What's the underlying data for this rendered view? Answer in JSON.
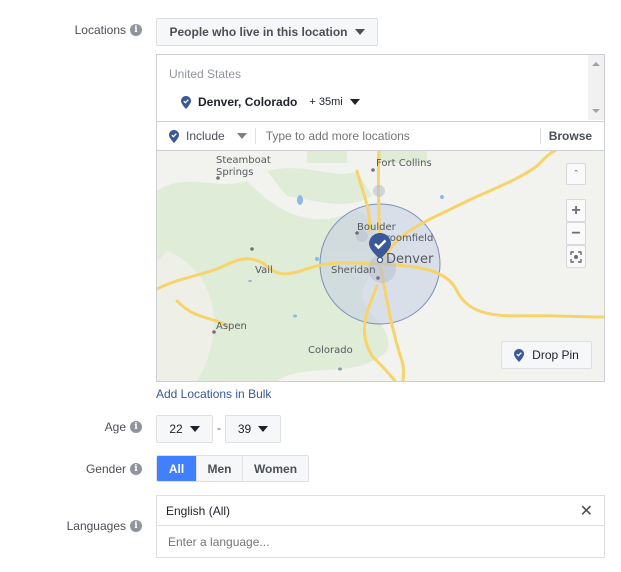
{
  "locations": {
    "label": "Locations",
    "type_dropdown": "People who live in this location",
    "country": "United States",
    "selected": {
      "name": "Denver, Colorado",
      "radius": "+ 35mi"
    },
    "include_label": "Include",
    "search_placeholder": "Type to add more locations",
    "browse_label": "Browse",
    "map": {
      "labels": [
        "Steamboat Springs",
        "Fort Collins",
        "Boulder",
        "Broomfield",
        "Denver",
        "Sheridan",
        "Vail",
        "Aspen",
        "Colorado"
      ],
      "drop_pin_label": "Drop Pin",
      "zoom_in": "+",
      "zoom_out": "−"
    },
    "bulk_link": "Add Locations in Bulk"
  },
  "age": {
    "label": "Age",
    "min": "22",
    "separator": "-",
    "max": "39"
  },
  "gender": {
    "label": "Gender",
    "options": [
      "All",
      "Men",
      "Women"
    ],
    "selected": "All"
  },
  "languages": {
    "label": "Languages",
    "selected": "English (All)",
    "placeholder": "Enter a language..."
  },
  "colors": {
    "accent": "#4080ff",
    "pin": "#3b5998",
    "link": "#365899"
  }
}
